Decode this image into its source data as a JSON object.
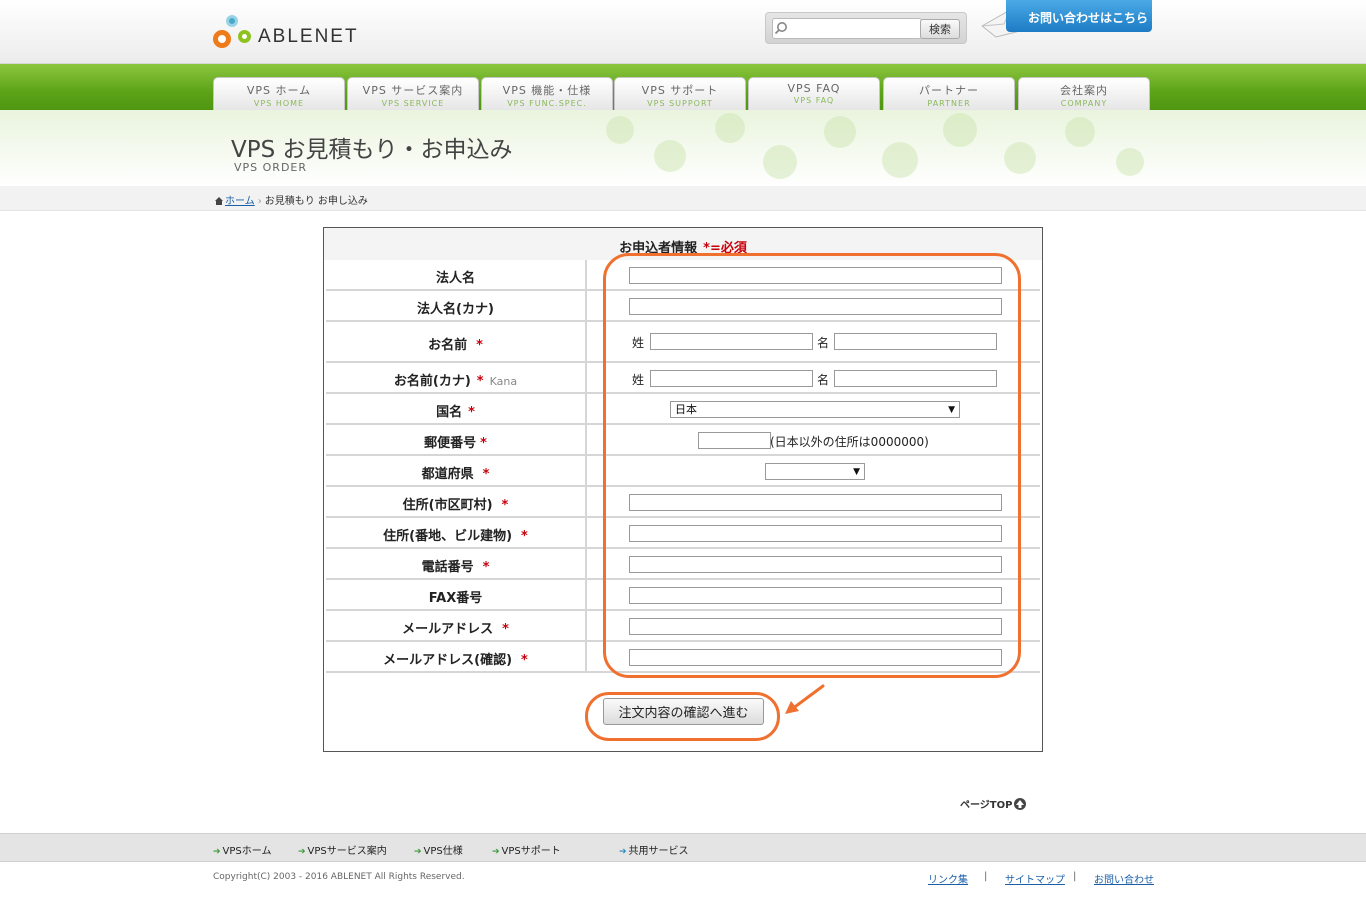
{
  "header": {
    "logo_text": "ABLENET",
    "search": {
      "placeholder": "",
      "button_label": "検索"
    },
    "contact_label": "お問い合わせはこちら"
  },
  "nav": {
    "tabs": [
      {
        "jp": "VPS ホーム",
        "en": "VPS HOME"
      },
      {
        "jp": "VPS サービス案内",
        "en": "VPS SERVICE"
      },
      {
        "jp": "VPS 機能・仕様",
        "en": "VPS FUNC.SPEC."
      },
      {
        "jp": "VPS サポート",
        "en": "VPS SUPPORT"
      },
      {
        "jp": "VPS FAQ",
        "en": "VPS FAQ"
      },
      {
        "jp": "パートナー",
        "en": "PARTNER"
      },
      {
        "jp": "会社案内",
        "en": "COMPANY"
      }
    ]
  },
  "page": {
    "title": "VPS お見積もり・お申込み",
    "title_en": "VPS ORDER"
  },
  "breadcrumb": {
    "home": "ホーム",
    "current": "お見積もり お申し込み"
  },
  "form": {
    "header": "お申込者情報",
    "required_note": "*=必須",
    "rows": [
      {
        "label": "法人名",
        "star": ""
      },
      {
        "label": "法人名(カナ)",
        "star": ""
      },
      {
        "label": "お名前",
        "star": "*",
        "sei": "姓",
        "mei": "名"
      },
      {
        "label": "お名前(カナ)",
        "star": "*",
        "kana": "Kana",
        "sei": "姓",
        "mei": "名"
      },
      {
        "label": "国名",
        "star": "*",
        "value": "日本"
      },
      {
        "label": "郵便番号",
        "star": "*",
        "note": "(日本以外の住所は0000000)"
      },
      {
        "label": "都道府県",
        "star": "*",
        "value": ""
      },
      {
        "label": "住所(市区町村)",
        "star": "*"
      },
      {
        "label": "住所(番地、ビル建物)",
        "star": "*"
      },
      {
        "label": "電話番号",
        "star": "*"
      },
      {
        "label": "FAX番号",
        "star": ""
      },
      {
        "label": "メールアドレス",
        "star": "*"
      },
      {
        "label": "メールアドレス(確認)",
        "star": "*"
      }
    ],
    "submit_label": "注文内容の確認へ進む"
  },
  "page_top": "ページTOP",
  "footer": {
    "nav": [
      "VPSホーム",
      "VPSサービス案内",
      "VPS仕様",
      "VPSサポート",
      "共用サービス"
    ],
    "copyright": "Copyright(C) 2003 - 2016 ABLENET All Rights Reserved.",
    "links": [
      "リンク集",
      "サイトマップ",
      "お問い合わせ"
    ],
    "sep": "|"
  },
  "colors": {
    "accent_green": "#5da418",
    "annotation_orange": "#f07030",
    "required_red": "#c8000a"
  }
}
